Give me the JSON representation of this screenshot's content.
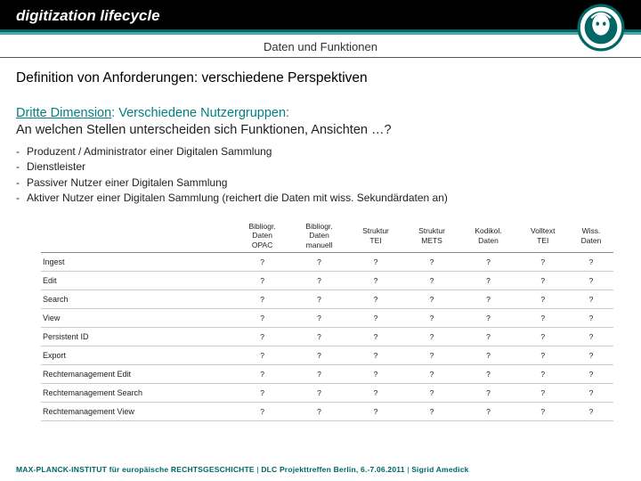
{
  "header": {
    "title": "digitization lifecycle",
    "subtitle": "Daten und Funktionen"
  },
  "content": {
    "heading": "Definition von Anforderungen: verschiedene Perspektiven",
    "dimension_label": "Dritte Dimension",
    "dimension_rest": ": Verschiedene Nutzergruppen:",
    "question": "An welchen Stellen unterscheiden sich Funktionen, Ansichten …?",
    "bullets": [
      "Produzent / Administrator einer Digitalen Sammlung",
      "Dienstleister",
      "Passiver Nutzer einer Digitalen Sammlung",
      "Aktiver Nutzer einer Digitalen Sammlung (reichert die Daten mit wiss. Sekundärdaten an)"
    ]
  },
  "table": {
    "columns": [
      "",
      "Bibliogr. Daten OPAC",
      "Bibliogr. Daten manuell",
      "Struktur TEI",
      "Struktur METS",
      "Kodikol. Daten",
      "Volltext TEI",
      "Wiss. Daten"
    ],
    "rows": [
      {
        "label": "Ingest",
        "cells": [
          "?",
          "?",
          "?",
          "?",
          "?",
          "?",
          "?"
        ]
      },
      {
        "label": "Edit",
        "cells": [
          "?",
          "?",
          "?",
          "?",
          "?",
          "?",
          "?"
        ]
      },
      {
        "label": "Search",
        "cells": [
          "?",
          "?",
          "?",
          "?",
          "?",
          "?",
          "?"
        ]
      },
      {
        "label": "View",
        "cells": [
          "?",
          "?",
          "?",
          "?",
          "?",
          "?",
          "?"
        ]
      },
      {
        "label": "Persistent ID",
        "cells": [
          "?",
          "?",
          "?",
          "?",
          "?",
          "?",
          "?"
        ]
      },
      {
        "label": "Export",
        "cells": [
          "?",
          "?",
          "?",
          "?",
          "?",
          "?",
          "?"
        ]
      },
      {
        "label": "Rechtemanagement Edit",
        "cells": [
          "?",
          "?",
          "?",
          "?",
          "?",
          "?",
          "?"
        ]
      },
      {
        "label": "Rechtemanagement Search",
        "cells": [
          "?",
          "?",
          "?",
          "?",
          "?",
          "?",
          "?"
        ]
      },
      {
        "label": "Rechtemanagement View",
        "cells": [
          "?",
          "?",
          "?",
          "?",
          "?",
          "?",
          "?"
        ]
      }
    ]
  },
  "footer": {
    "institute": "MAX-PLANCK-INSTITUT für europäische RECHTSGESCHICHTE",
    "sep1": "  |  ",
    "event": "DLC Projekttreffen Berlin, 6.-7.06.2011",
    "sep2": "  |  ",
    "author": "Sigrid Amedick"
  },
  "colors": {
    "teal": "#008080"
  }
}
